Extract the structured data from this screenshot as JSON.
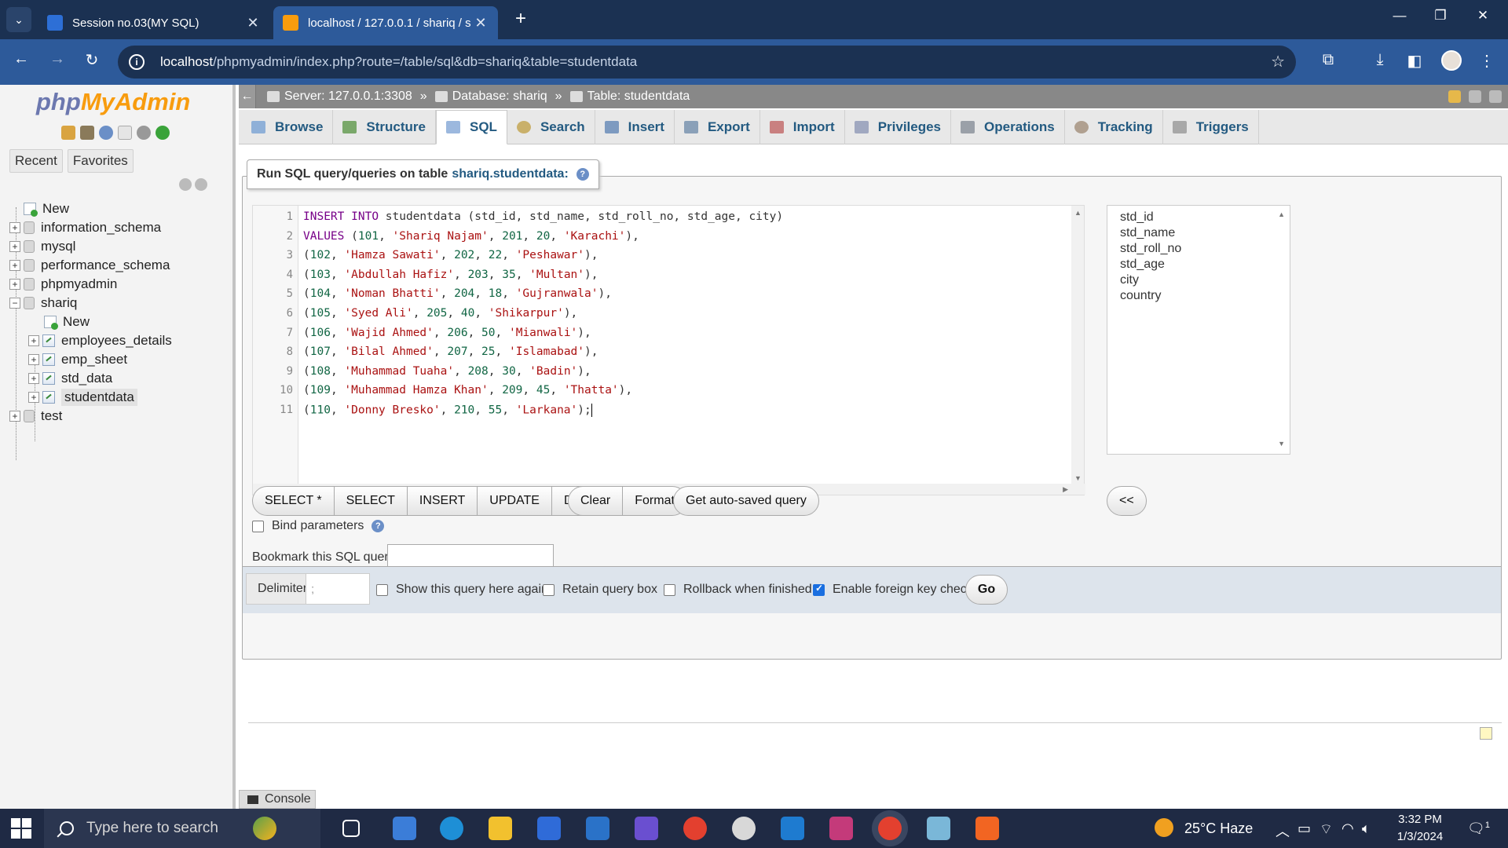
{
  "browser": {
    "tabs": [
      {
        "title": "Session no.03(MY SQL)",
        "favicon_color": "#2d6fd6"
      },
      {
        "title": "localhost / 127.0.0.1 / shariq / s",
        "favicon_color": "#f89c0e"
      }
    ],
    "new_tab": "+",
    "url_host": "localhost",
    "url_path": "/phpmyadmin/index.php?route=/table/sql&db=shariq&table=studentdata"
  },
  "pma": {
    "logo_php": "php",
    "logo_my": "MyAdmin",
    "nav_tabs": [
      "Recent",
      "Favorites"
    ],
    "tree": {
      "new": "New",
      "databases": [
        "information_schema",
        "mysql",
        "performance_schema",
        "phpmyadmin",
        "shariq"
      ],
      "shariq_children": {
        "new": "New",
        "tables": [
          "employees_details",
          "emp_sheet",
          "std_data",
          "studentdata"
        ]
      },
      "last_db": "test"
    }
  },
  "breadcrumb": {
    "server": "Server: 127.0.0.1:3308",
    "database": "Database: shariq",
    "table": "Table: studentdata",
    "sep": "»"
  },
  "menu_tabs": [
    "Browse",
    "Structure",
    "SQL",
    "Search",
    "Insert",
    "Export",
    "Import",
    "Privileges",
    "Operations",
    "Tracking",
    "Triggers"
  ],
  "active_tab": "SQL",
  "sql_panel": {
    "legend_prefix": "Run SQL query/queries on table",
    "legend_table": "shariq.studentdata:",
    "line_numbers": [
      "1",
      "2",
      "3",
      "4",
      "5",
      "6",
      "7",
      "8",
      "9",
      "10",
      "11"
    ],
    "columns": [
      "std_id",
      "std_name",
      "std_roll_no",
      "std_age",
      "city",
      "country"
    ],
    "query_buttons": [
      "SELECT *",
      "SELECT",
      "INSERT",
      "UPDATE",
      "DELETE"
    ],
    "edit_buttons": [
      "Clear",
      "Format"
    ],
    "autosave_button": "Get auto-saved query",
    "insert_column_button": "<<",
    "bind_parameters": "Bind parameters",
    "bookmark_label": "Bookmark this SQL query:",
    "bookmark_value": ""
  },
  "options": {
    "delimiter_label": "Delimiter",
    "delimiter_value": ";",
    "show_query_again": {
      "label": "Show this query here again",
      "checked": false
    },
    "retain_query_box": {
      "label": "Retain query box",
      "checked": false
    },
    "rollback_when_finished": {
      "label": "Rollback when finished",
      "checked": false
    },
    "enable_fk_checks": {
      "label": "Enable foreign key checks",
      "checked": true
    },
    "go": "Go"
  },
  "console_label": "Console",
  "taskbar": {
    "search_placeholder": "Type here to search",
    "weather": "25°C  Haze",
    "time": "3:32 PM",
    "date": "1/3/2024",
    "notification_count": "1"
  }
}
